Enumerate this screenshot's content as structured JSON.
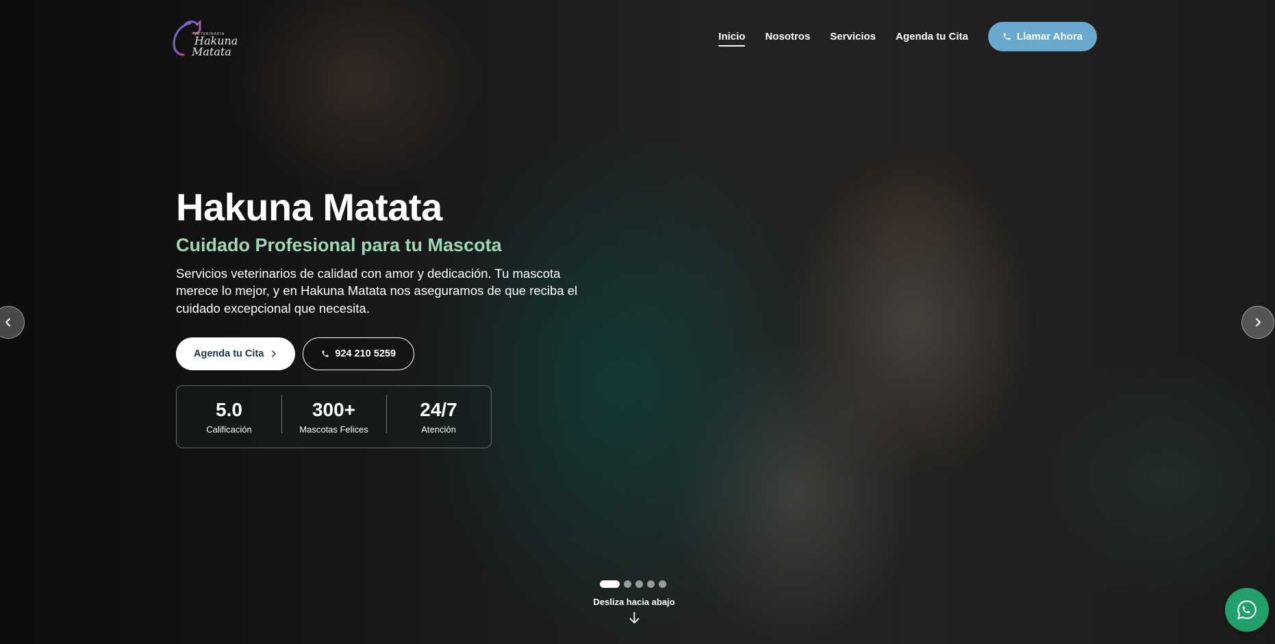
{
  "brand": {
    "logo_top": "VETERINARIA",
    "logo_line1": "Hakuna",
    "logo_line2": "Matata"
  },
  "nav": {
    "items": [
      {
        "label": "Inicio",
        "active": true
      },
      {
        "label": "Nosotros",
        "active": false
      },
      {
        "label": "Servicios",
        "active": false
      },
      {
        "label": "Agenda tu Cita",
        "active": false
      }
    ],
    "call_label": "Llamar Ahora"
  },
  "hero": {
    "title": "Hakuna Matata",
    "subtitle": "Cuidado Profesional para tu Mascota",
    "description": "Servicios veterinarios de calidad con amor y dedicación. Tu mascota merece lo mejor, y en Hakuna Matata nos aseguramos de que reciba el cuidado excepcional que necesita.",
    "primary_cta": "Agenda tu Cita",
    "phone_cta": "924 210 5259"
  },
  "stats": [
    {
      "value": "5.0",
      "label": "Calificación"
    },
    {
      "value": "300+",
      "label": "Mascotas Felices"
    },
    {
      "value": "24/7",
      "label": "Atención"
    }
  ],
  "carousel": {
    "slide_count": 5,
    "active_index": 0
  },
  "scroll_hint": "Desliza hacia abajo",
  "colors": {
    "accent_blue": "#6aa9cf",
    "subtitle_green": "#9fd8b4",
    "whatsapp_green": "#22a06b",
    "cta_text": "#14364b"
  },
  "icons": {
    "phone": "phone-icon",
    "chevron_right": "chevron-right-icon",
    "chevron_left": "chevron-left-icon",
    "arrow_down": "arrow-down-icon",
    "whatsapp": "whatsapp-icon"
  }
}
